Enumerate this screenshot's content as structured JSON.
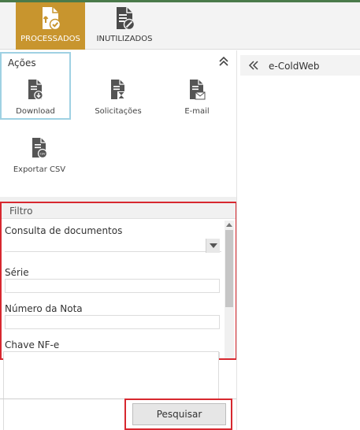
{
  "ribbon": {
    "tabs": [
      {
        "label": "PROCESSADOS",
        "active": true,
        "icon": "document-check-icon"
      },
      {
        "label": "INUTILIZADOS",
        "active": false,
        "icon": "document-blocked-icon"
      }
    ],
    "active_color": "#c8952e"
  },
  "acoes": {
    "title": "Ações",
    "items": [
      {
        "label": "Download",
        "icon": "document-download-icon"
      },
      {
        "label": "Solicitações",
        "icon": "document-hourglass-icon"
      },
      {
        "label": "E-mail",
        "icon": "document-mail-icon"
      },
      {
        "label": "Exportar CSV",
        "icon": "document-csv-icon",
        "badge": "csv"
      }
    ]
  },
  "filtro": {
    "title": "Filtro",
    "fields": [
      {
        "label": "Consulta de documentos",
        "type": "select",
        "value": ""
      },
      {
        "label": "Série",
        "type": "text",
        "value": ""
      },
      {
        "label": "Número da Nota",
        "type": "text",
        "value": ""
      },
      {
        "label": "Chave NF-e",
        "type": "textarea",
        "value": ""
      }
    ],
    "search_label": "Pesquisar"
  },
  "right_panel": {
    "title": "e-ColdWeb"
  },
  "colors": {
    "highlight_red": "#d7282f",
    "highlight_blue": "#9fd1e3"
  }
}
